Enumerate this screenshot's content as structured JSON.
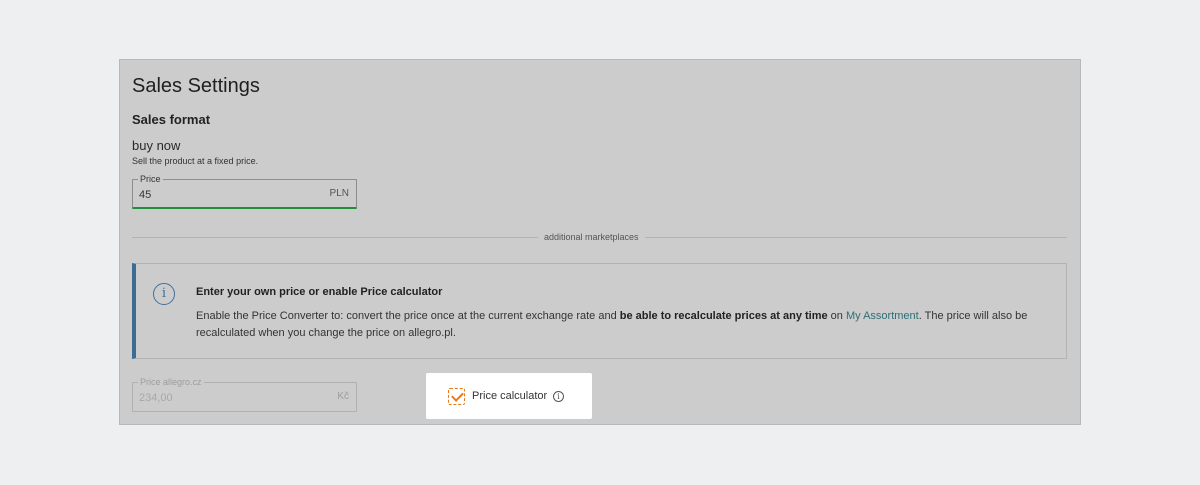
{
  "sales_settings": {
    "title": "Sales Settings",
    "sales_format_heading": "Sales format",
    "format_name": "buy now",
    "format_description": "Sell the product at a fixed price."
  },
  "price_field": {
    "label": "Price",
    "value": "45",
    "currency": "PLN"
  },
  "divider": {
    "label": "additional marketplaces"
  },
  "info_box": {
    "icon": "info-icon",
    "heading": "Enter your own price or enable Price calculator",
    "body_part1": "Enable the Price Converter to: convert the price once at the current exchange rate and ",
    "body_bold": "be able to recalculate prices at any time",
    "body_part2": " on ",
    "body_link": "My Assortment",
    "body_part3": ". The price will also be recalculated when you change the price on allegro.pl."
  },
  "price_cz_field": {
    "label": "Price allegro.cz",
    "value": "234,00",
    "currency": "Kč"
  },
  "price_calculator": {
    "label": "Price calculator",
    "checked": true,
    "info_icon": "info-icon"
  },
  "colors": {
    "panel_bg": "#cccccc",
    "accent_green": "#1f8f3a",
    "info_border": "#3a6c94",
    "checkbox_orange": "#e87b1a",
    "link": "#2d6e78"
  }
}
